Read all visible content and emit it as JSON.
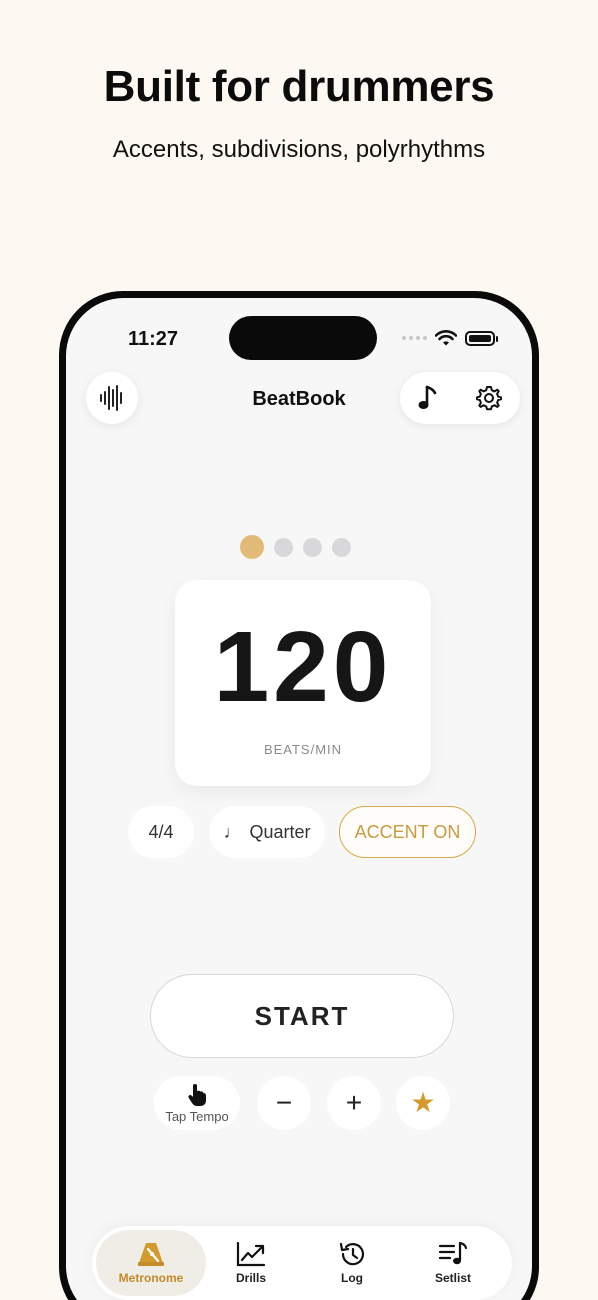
{
  "promo": {
    "headline": "Built for drummers",
    "subline": "Accents, subdivisions, polyrhythms"
  },
  "status_bar": {
    "time": "11:27"
  },
  "header": {
    "title": "BeatBook",
    "left_icon": "waveform-icon",
    "right_icons": [
      "music-note-icon",
      "gear-icon"
    ]
  },
  "pager": {
    "pages": 4,
    "active_index": 0
  },
  "tempo": {
    "value": "120",
    "unit_label": "BEATS/MIN"
  },
  "chips": {
    "time_signature": "4/4",
    "subdivision_symbol": "♩",
    "subdivision": "Quarter",
    "accent": "ACCENT ON"
  },
  "controls": {
    "start_label": "START",
    "tap_tempo_label": "Tap Tempo",
    "minus_symbol": "−",
    "plus_symbol": "+",
    "favorite_symbol": "★"
  },
  "tabs": [
    {
      "label": "Metronome",
      "icon": "metronome-icon",
      "active": true
    },
    {
      "label": "Drills",
      "icon": "chart-trend-icon",
      "active": false
    },
    {
      "label": "Log",
      "icon": "history-icon",
      "active": false
    },
    {
      "label": "Setlist",
      "icon": "playlist-icon",
      "active": false
    }
  ],
  "colors": {
    "background": "#fdf8f1",
    "accent": "#e2ba78",
    "accent_text": "#c99a40",
    "active_tab_text": "#c58a2a"
  }
}
